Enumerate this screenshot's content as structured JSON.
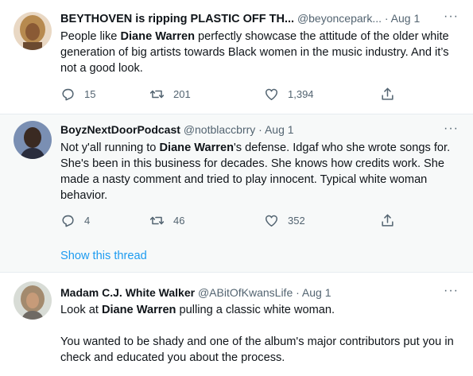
{
  "tweets": [
    {
      "display_name": "BEYTHOVEN is ripping PLASTIC OFF TH...",
      "handle": "@beyoncepark...",
      "date": "· Aug 1",
      "text_pre": "People like ",
      "text_bold": "Diane Warren",
      "text_post": " perfectly showcase the attitude of the older white generation of big artists towards Black women in the music industry. And it’s not a good look.",
      "replies": "15",
      "retweets": "201",
      "likes": "1,394"
    },
    {
      "display_name": "BoyzNextDoorPodcast",
      "handle": "@notblaccbrry",
      "date": "· Aug 1",
      "text_pre": "Not y'all running to ",
      "text_bold": "Diane Warren",
      "text_post": "'s defense. Idgaf who she wrote songs for. She's been in this business for decades. She knows how credits work. She made a nasty comment and tried to play innocent. Typical white woman behavior.",
      "replies": "4",
      "retweets": "46",
      "likes": "352",
      "show_thread": "Show this thread"
    },
    {
      "display_name": "Madam C.J. White Walker",
      "handle": "@ABitOfKwansLife",
      "date": "· Aug 1",
      "text_pre": "Look at ",
      "text_bold": "Diane Warren",
      "text_post": " pulling a classic white woman.",
      "text_p2": "You wanted to be shady and one of the album's major contributors put you in check and educated you about the process."
    }
  ],
  "icons": {
    "more": "more-horizontal-icon",
    "reply": "reply-icon",
    "retweet": "retweet-icon",
    "like": "heart-icon",
    "share": "share-icon"
  },
  "colors": {
    "link": "#1d9bf0",
    "muted": "#536471",
    "text": "#0f1419",
    "highlight_bg": "#f7f9f9"
  }
}
